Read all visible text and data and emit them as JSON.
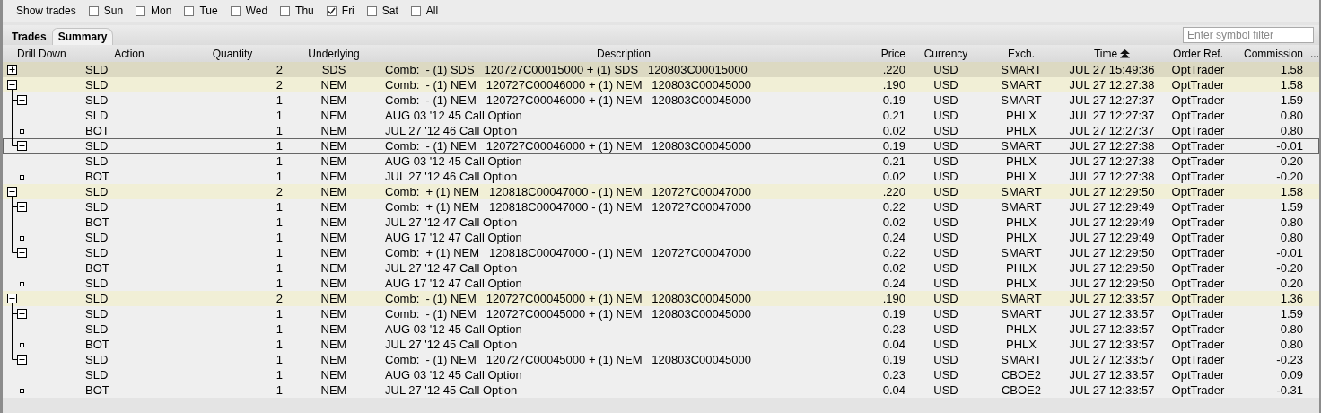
{
  "filter_bar": {
    "label": "Show trades",
    "days": [
      {
        "label": "Sun",
        "checked": false
      },
      {
        "label": "Mon",
        "checked": false
      },
      {
        "label": "Tue",
        "checked": false
      },
      {
        "label": "Wed",
        "checked": false
      },
      {
        "label": "Thu",
        "checked": false
      },
      {
        "label": "Fri",
        "checked": true
      },
      {
        "label": "Sat",
        "checked": false
      },
      {
        "label": "All",
        "checked": false
      }
    ]
  },
  "tabs": [
    {
      "label": "Trades",
      "selected": false
    },
    {
      "label": "Summary",
      "selected": true
    }
  ],
  "symbol_filter": {
    "placeholder": "Enter symbol filter"
  },
  "table": {
    "tree_column": {
      "heading": "Drill Down"
    },
    "columns": [
      {
        "heading": "Action",
        "sorted": false
      },
      {
        "heading": "Quantity",
        "sorted": false
      },
      {
        "heading": "Underlying",
        "sorted": false
      },
      {
        "heading": "Description",
        "sorted": false
      },
      {
        "heading": "Price",
        "sorted": false
      },
      {
        "heading": "Currency",
        "sorted": false
      },
      {
        "heading": "Exch.",
        "sorted": false
      },
      {
        "heading": "Time",
        "sorted": true
      },
      {
        "heading": "Order Ref.",
        "sorted": false
      },
      {
        "heading": "Commission",
        "sorted": false
      },
      {
        "heading": "...",
        "sorted": false
      }
    ],
    "rows": [
      {
        "expanded": false,
        "selected": true,
        "focused": false,
        "cells": [
          "SLD",
          "2",
          "SDS",
          "Comb:  - (1) SDS   120727C00015000 + (1) SDS   120803C00015000",
          ".220",
          "USD",
          "SMART",
          "JUL 27 15:49:36",
          "OptTrader",
          "1.58"
        ]
      },
      {
        "expanded": true,
        "selected": false,
        "focused": false,
        "cells": [
          "SLD",
          "2",
          "NEM",
          "Comb:  - (1) NEM   120727C00046000 + (1) NEM   120803C00045000",
          ".190",
          "USD",
          "SMART",
          "JUL 27 12:27:38",
          "OptTrader",
          "1.58"
        ],
        "children": [
          {
            "expanded": true,
            "selected": false,
            "focused": false,
            "cells": [
              "SLD",
              "1",
              "NEM",
              "Comb:  - (1) NEM   120727C00046000 + (1) NEM   120803C00045000",
              "0.19",
              "USD",
              "SMART",
              "JUL 27 12:27:37",
              "OptTrader",
              "1.59"
            ],
            "children": [
              {
                "selected": false,
                "focused": false,
                "cells": [
                  "SLD",
                  "1",
                  "NEM",
                  "AUG 03 '12 45 Call Option",
                  "0.21",
                  "USD",
                  "PHLX",
                  "JUL 27 12:27:37",
                  "OptTrader",
                  "0.80"
                ]
              },
              {
                "selected": false,
                "focused": false,
                "cells": [
                  "BOT",
                  "1",
                  "NEM",
                  "JUL 27 '12 46 Call Option",
                  "0.02",
                  "USD",
                  "PHLX",
                  "JUL 27 12:27:37",
                  "OptTrader",
                  "0.80"
                ]
              }
            ]
          },
          {
            "expanded": true,
            "selected": false,
            "focused": true,
            "cells": [
              "SLD",
              "1",
              "NEM",
              "Comb:  - (1) NEM   120727C00046000 + (1) NEM   120803C00045000",
              "0.19",
              "USD",
              "SMART",
              "JUL 27 12:27:38",
              "OptTrader",
              "-0.01"
            ],
            "children": [
              {
                "selected": false,
                "focused": false,
                "cells": [
                  "SLD",
                  "1",
                  "NEM",
                  "AUG 03 '12 45 Call Option",
                  "0.21",
                  "USD",
                  "PHLX",
                  "JUL 27 12:27:38",
                  "OptTrader",
                  "0.20"
                ]
              },
              {
                "selected": false,
                "focused": false,
                "cells": [
                  "BOT",
                  "1",
                  "NEM",
                  "JUL 27 '12 46 Call Option",
                  "0.02",
                  "USD",
                  "PHLX",
                  "JUL 27 12:27:38",
                  "OptTrader",
                  "-0.20"
                ]
              }
            ]
          }
        ]
      },
      {
        "expanded": true,
        "selected": false,
        "focused": false,
        "cells": [
          "SLD",
          "2",
          "NEM",
          "Comb:  + (1) NEM   120818C00047000 - (1) NEM   120727C00047000",
          ".220",
          "USD",
          "SMART",
          "JUL 27 12:29:50",
          "OptTrader",
          "1.58"
        ],
        "children": [
          {
            "expanded": true,
            "selected": false,
            "focused": false,
            "cells": [
              "SLD",
              "1",
              "NEM",
              "Comb:  + (1) NEM   120818C00047000 - (1) NEM   120727C00047000",
              "0.22",
              "USD",
              "SMART",
              "JUL 27 12:29:49",
              "OptTrader",
              "1.59"
            ],
            "children": [
              {
                "selected": false,
                "focused": false,
                "cells": [
                  "BOT",
                  "1",
                  "NEM",
                  "JUL 27 '12 47 Call Option",
                  "0.02",
                  "USD",
                  "PHLX",
                  "JUL 27 12:29:49",
                  "OptTrader",
                  "0.80"
                ]
              },
              {
                "selected": false,
                "focused": false,
                "cells": [
                  "SLD",
                  "1",
                  "NEM",
                  "AUG 17 '12 47 Call Option",
                  "0.24",
                  "USD",
                  "PHLX",
                  "JUL 27 12:29:49",
                  "OptTrader",
                  "0.80"
                ]
              }
            ]
          },
          {
            "expanded": true,
            "selected": false,
            "focused": false,
            "cells": [
              "SLD",
              "1",
              "NEM",
              "Comb:  + (1) NEM   120818C00047000 - (1) NEM   120727C00047000",
              "0.22",
              "USD",
              "SMART",
              "JUL 27 12:29:50",
              "OptTrader",
              "-0.01"
            ],
            "children": [
              {
                "selected": false,
                "focused": false,
                "cells": [
                  "BOT",
                  "1",
                  "NEM",
                  "JUL 27 '12 47 Call Option",
                  "0.02",
                  "USD",
                  "PHLX",
                  "JUL 27 12:29:50",
                  "OptTrader",
                  "-0.20"
                ]
              },
              {
                "selected": false,
                "focused": false,
                "cells": [
                  "SLD",
                  "1",
                  "NEM",
                  "AUG 17 '12 47 Call Option",
                  "0.24",
                  "USD",
                  "PHLX",
                  "JUL 27 12:29:50",
                  "OptTrader",
                  "0.20"
                ]
              }
            ]
          }
        ]
      },
      {
        "expanded": true,
        "selected": false,
        "focused": false,
        "cells": [
          "SLD",
          "2",
          "NEM",
          "Comb:  - (1) NEM   120727C00045000 + (1) NEM   120803C00045000",
          ".190",
          "USD",
          "SMART",
          "JUL 27 12:33:57",
          "OptTrader",
          "1.36"
        ],
        "children": [
          {
            "expanded": true,
            "selected": false,
            "focused": false,
            "cells": [
              "SLD",
              "1",
              "NEM",
              "Comb:  - (1) NEM   120727C00045000 + (1) NEM   120803C00045000",
              "0.19",
              "USD",
              "SMART",
              "JUL 27 12:33:57",
              "OptTrader",
              "1.59"
            ],
            "children": [
              {
                "selected": false,
                "focused": false,
                "cells": [
                  "SLD",
                  "1",
                  "NEM",
                  "AUG 03 '12 45 Call Option",
                  "0.23",
                  "USD",
                  "PHLX",
                  "JUL 27 12:33:57",
                  "OptTrader",
                  "0.80"
                ]
              },
              {
                "selected": false,
                "focused": false,
                "cells": [
                  "BOT",
                  "1",
                  "NEM",
                  "JUL 27 '12 45 Call Option",
                  "0.04",
                  "USD",
                  "PHLX",
                  "JUL 27 12:33:57",
                  "OptTrader",
                  "0.80"
                ]
              }
            ]
          },
          {
            "expanded": true,
            "selected": false,
            "focused": false,
            "cells": [
              "SLD",
              "1",
              "NEM",
              "Comb:  - (1) NEM   120727C00045000 + (1) NEM   120803C00045000",
              "0.19",
              "USD",
              "SMART",
              "JUL 27 12:33:57",
              "OptTrader",
              "-0.23"
            ],
            "children": [
              {
                "selected": false,
                "focused": false,
                "cells": [
                  "SLD",
                  "1",
                  "NEM",
                  "AUG 03 '12 45 Call Option",
                  "0.23",
                  "USD",
                  "CBOE2",
                  "JUL 27 12:33:57",
                  "OptTrader",
                  "0.09"
                ]
              },
              {
                "selected": false,
                "focused": false,
                "cells": [
                  "BOT",
                  "1",
                  "NEM",
                  "JUL 27 '12 45 Call Option",
                  "0.04",
                  "USD",
                  "CBOE2",
                  "JUL 27 12:33:57",
                  "OptTrader",
                  "-0.31"
                ]
              }
            ]
          }
        ]
      }
    ]
  }
}
